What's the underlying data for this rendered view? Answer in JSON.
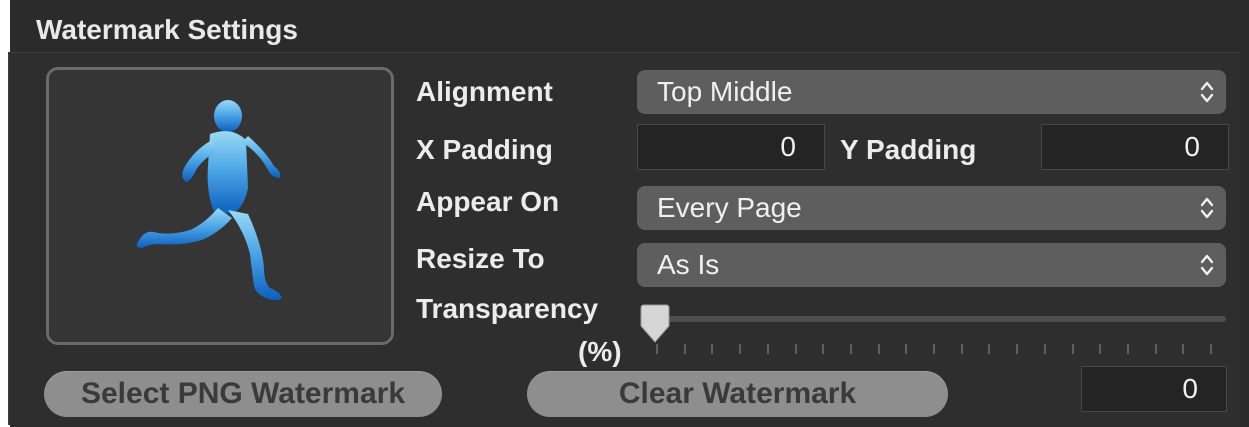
{
  "panel": {
    "title": "Watermark Settings"
  },
  "image_well": {
    "icon": "running-man"
  },
  "alignment": {
    "label": "Alignment",
    "value": "Top Middle"
  },
  "x_padding": {
    "label": "X Padding",
    "value": "0"
  },
  "y_padding": {
    "label": "Y Padding",
    "value": "0"
  },
  "appear_on": {
    "label": "Appear On",
    "value": "Every Page"
  },
  "resize_to": {
    "label": "Resize To",
    "value": "As Is"
  },
  "transparency": {
    "label_line1": "Transparency",
    "label_line2": "(%)",
    "value": 0,
    "value_text": "0"
  },
  "buttons": {
    "select": "Select PNG Watermark",
    "clear": "Clear Watermark"
  },
  "colors": {
    "icon_light": "#8fd4f2",
    "icon_dark": "#1a6fc9"
  }
}
